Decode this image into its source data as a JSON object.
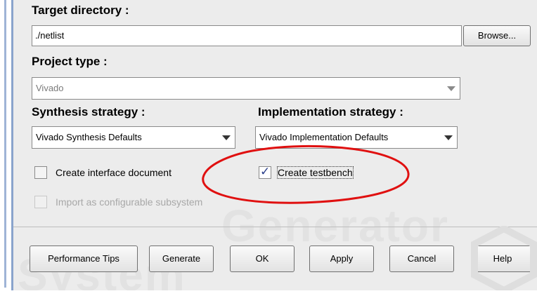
{
  "target_directory": {
    "label": "Target directory :",
    "value": "./netlist",
    "browse_label": "Browse..."
  },
  "project_type": {
    "label": "Project type :",
    "value": "Vivado"
  },
  "synthesis": {
    "label": "Synthesis strategy :",
    "value": "Vivado Synthesis Defaults"
  },
  "implementation": {
    "label": "Implementation strategy :",
    "value": "Vivado Implementation Defaults"
  },
  "options": {
    "create_interface_document": {
      "label": "Create interface document",
      "checked": false
    },
    "create_testbench": {
      "label": "Create testbench",
      "checked": true
    },
    "import_configurable": {
      "label": "Import as configurable subsystem",
      "checked": false,
      "disabled": true
    }
  },
  "buttons": {
    "performance_tips": "Performance Tips",
    "generate": "Generate",
    "ok": "OK",
    "apply": "Apply",
    "cancel": "Cancel",
    "help": "Help"
  },
  "colors": {
    "dialog_bg": "#ececec",
    "annotation_red": "#e01010",
    "check_mark": "#2b3f8a"
  },
  "icons": {
    "combo_arrow": "chevron-down-icon",
    "check_mark": "checkmark-icon",
    "logo": "hexagon-logo"
  }
}
